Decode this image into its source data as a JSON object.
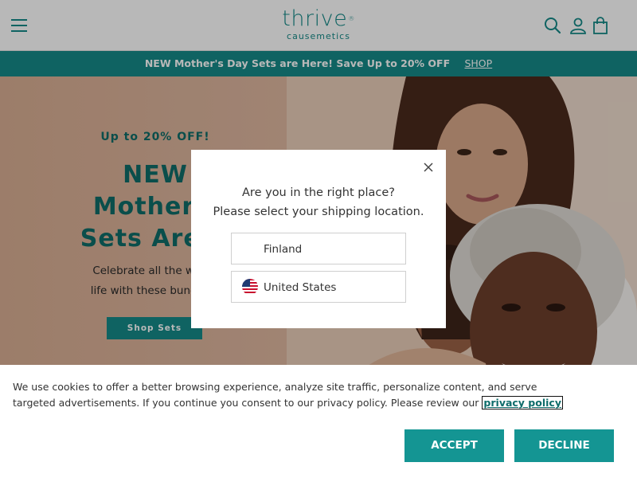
{
  "header": {
    "logo_main": "thrive",
    "logo_mark": "®",
    "logo_sub": "causemetics",
    "icons": [
      "menu-icon",
      "search-icon",
      "account-icon",
      "cart-icon"
    ]
  },
  "promo": {
    "text": "NEW Mother's Day Sets are Here! Save Up to 20% OFF",
    "link": "SHOP"
  },
  "hero": {
    "eyebrow": "Up to 20% OFF!",
    "title_line1": "NEW",
    "title_line2": "Mother's",
    "title_line3": "Sets Are H",
    "desc_line1": "Celebrate all the wome",
    "desc_line2": "life with these bundled l",
    "cta": "Shop Sets"
  },
  "modal": {
    "question_line1": "Are you in the right place?",
    "question_line2": "Please select your shipping location.",
    "countries": [
      {
        "label": "Finland"
      },
      {
        "label": "United States",
        "flag": "us-flag-icon"
      }
    ],
    "close_icon": "close-icon"
  },
  "cookie": {
    "text": "We use cookies to offer a better browsing experience, analyze site traffic, personalize content, and serve targeted advertisements. If you continue you consent to our privacy policy. Please review our",
    "link": "privacy policy",
    "accept": "ACCEPT",
    "decline": "DECLINE"
  },
  "colors": {
    "brand": "#168a88",
    "brand_dark": "#0f6d69",
    "button": "#149593"
  }
}
